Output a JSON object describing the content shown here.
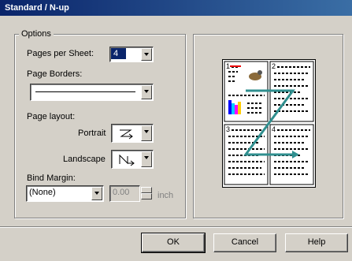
{
  "window": {
    "title": "Standard / N-up"
  },
  "options": {
    "group_label": "Options",
    "pages_per_sheet": {
      "label": "Pages per Sheet:",
      "value": "4"
    },
    "page_borders": {
      "label": "Page Borders:"
    },
    "page_layout": {
      "label": "Page layout:",
      "portrait_label": "Portrait",
      "landscape_label": "Landscape"
    },
    "bind_margin": {
      "label": "Bind Margin:",
      "value": "(None)",
      "amount": "0.00",
      "unit": "inch"
    }
  },
  "preview": {
    "page_numbers": [
      "1",
      "2",
      "3",
      "4"
    ]
  },
  "buttons": {
    "ok": "OK",
    "cancel": "Cancel",
    "help": "Help"
  }
}
